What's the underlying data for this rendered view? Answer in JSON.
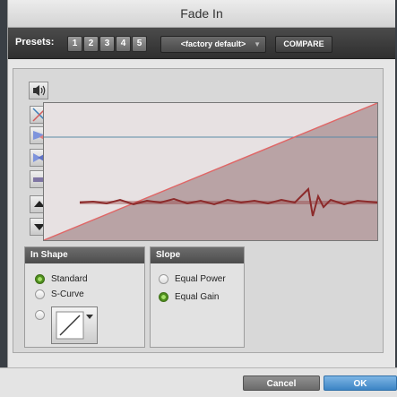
{
  "window": {
    "title": "Fade In"
  },
  "presets": {
    "label": "Presets:",
    "slots": [
      "1",
      "2",
      "3",
      "4",
      "5"
    ],
    "selected_preset": "<factory default>",
    "compare_label": "COMPARE"
  },
  "tools": {
    "icons": [
      "speaker-icon",
      "no-fade-icon",
      "fade-in-tool-icon",
      "crossfade-icon",
      "dim-icon",
      "scroll-up-icon",
      "scroll-down-icon"
    ]
  },
  "in_shape": {
    "title": "In Shape",
    "options": [
      {
        "label": "Standard",
        "selected": true
      },
      {
        "label": "S-Curve",
        "selected": false
      },
      {
        "label": "",
        "selected": false
      }
    ]
  },
  "slope": {
    "title": "Slope",
    "options": [
      {
        "label": "Equal Power",
        "selected": false
      },
      {
        "label": "Equal Gain",
        "selected": true
      }
    ]
  },
  "footer": {
    "cancel_label": "Cancel",
    "ok_label": "OK"
  },
  "colors": {
    "graph_fill": "#b9a3a5",
    "curve_line": "#e06666",
    "waveform": "#8c2b2b",
    "reference_line": "#5b8aa7",
    "ok_button": "#3c84c5"
  }
}
